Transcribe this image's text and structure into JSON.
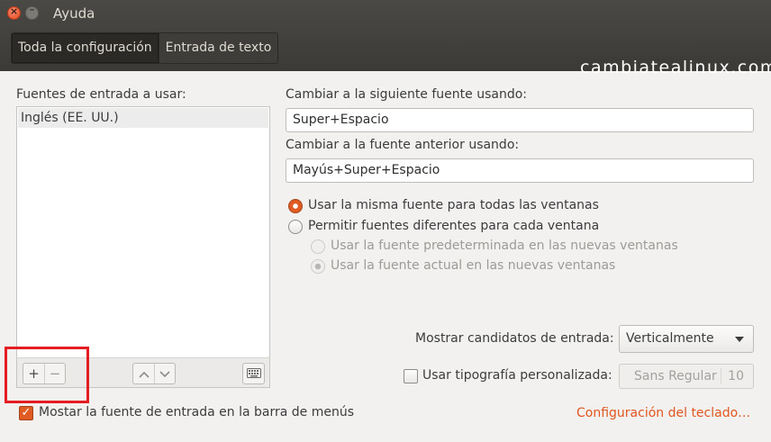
{
  "window": {
    "title": "Ayuda"
  },
  "tabs": [
    {
      "label": "Toda la configuración",
      "active": true
    },
    {
      "label": "Entrada de texto",
      "active": false
    }
  ],
  "watermark": "cambiatealinux.com",
  "sources": {
    "label": "Fuentes de entrada a usar:",
    "items": [
      "Inglés (EE. UU.)"
    ],
    "toolbar": {
      "add": "+",
      "remove": "−",
      "up": "⌃",
      "down": "⌄",
      "keyboard_icon": "keyboard-icon"
    }
  },
  "next_source": {
    "label": "Cambiar a la siguiente fuente usando:",
    "value": "Super+Espacio"
  },
  "prev_source": {
    "label": "Cambiar a la fuente anterior usando:",
    "value": "Mayús+Super+Espacio"
  },
  "radios": {
    "same": {
      "label": "Usar la misma fuente para todas las ventanas",
      "checked": true
    },
    "different": {
      "label": "Permitir fuentes diferentes para cada ventana",
      "checked": false
    },
    "default_new": {
      "label": "Usar la fuente predeterminada en las nuevas ventanas",
      "checked": false,
      "disabled": true
    },
    "current_new": {
      "label": "Usar la fuente actual en las nuevas ventanas",
      "checked": true,
      "disabled": true
    }
  },
  "candidates": {
    "label": "Mostrar candidatos de entrada:",
    "value": "Verticalmente"
  },
  "custom_font": {
    "label": "Usar tipografía personalizada:",
    "checked": false,
    "font_name": "Sans Regular",
    "font_size": "10"
  },
  "menu_bar_check": {
    "label": "Mostar la fuente de entrada en la barra de menús",
    "checked": true
  },
  "keyboard_link": "Configuración del teclado…",
  "colors": {
    "accent": "#e05a23",
    "titlebar": "#3c3b37",
    "highlight_box": "#e31d22"
  }
}
